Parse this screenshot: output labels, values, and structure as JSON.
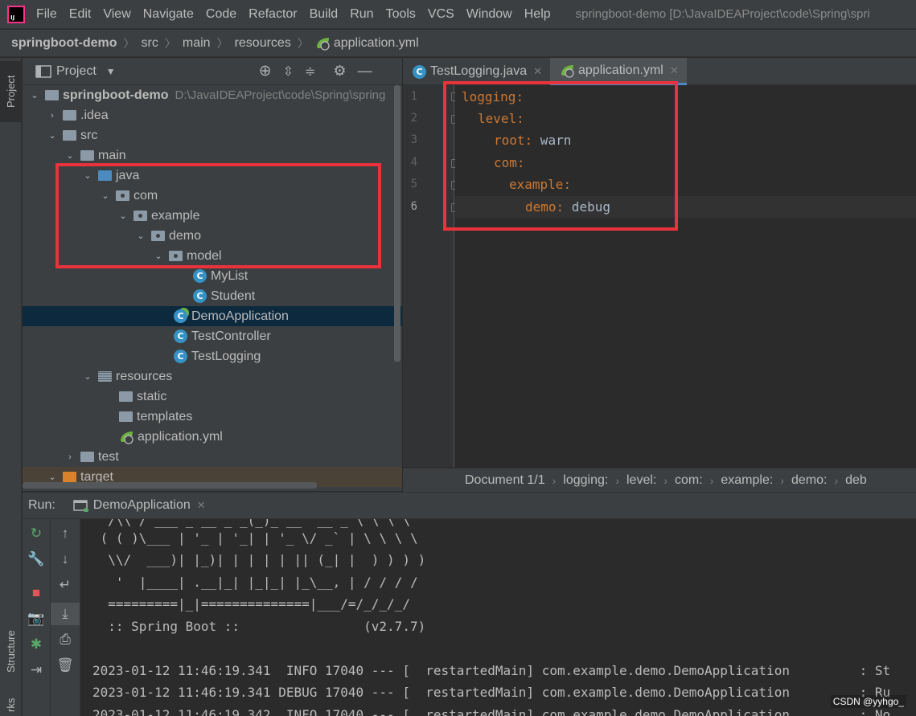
{
  "app": {
    "logo_text": "IJ",
    "window_title": "springboot-demo [D:\\JavaIDEAProject\\code\\Spring\\spri"
  },
  "menu": [
    "File",
    "Edit",
    "View",
    "Navigate",
    "Code",
    "Refactor",
    "Build",
    "Run",
    "Tools",
    "VCS",
    "Window",
    "Help"
  ],
  "breadcrumbs": [
    "springboot-demo",
    "src",
    "main",
    "resources",
    "application.yml"
  ],
  "left_strip": {
    "project_tab": "Project",
    "structure_tab": "Structure",
    "bookmarks_tab": "rks"
  },
  "project_panel": {
    "title": "Project",
    "tree": [
      {
        "label": "springboot-demo",
        "path": "D:\\JavaIDEAProject\\code\\Spring\\spring"
      },
      {
        "label": ".idea"
      },
      {
        "label": "src"
      },
      {
        "label": "main"
      },
      {
        "label": "java"
      },
      {
        "label": "com"
      },
      {
        "label": "example"
      },
      {
        "label": "demo"
      },
      {
        "label": "model"
      },
      {
        "label": "MyList"
      },
      {
        "label": "Student"
      },
      {
        "label": "DemoApplication"
      },
      {
        "label": "TestController"
      },
      {
        "label": "TestLogging"
      },
      {
        "label": "resources"
      },
      {
        "label": "static"
      },
      {
        "label": "templates"
      },
      {
        "label": "application.yml"
      },
      {
        "label": "test"
      },
      {
        "label": "target"
      }
    ]
  },
  "editor": {
    "tabs": [
      {
        "label": "TestLogging.java",
        "active": false
      },
      {
        "label": "application.yml",
        "active": true
      }
    ],
    "line_numbers": [
      "1",
      "2",
      "3",
      "4",
      "5",
      "6"
    ],
    "lines": [
      {
        "key": "logging",
        "colon": ":",
        "value": ""
      },
      {
        "key": "level",
        "colon": ":",
        "value": ""
      },
      {
        "key": "root",
        "colon": ":",
        "value": " warn"
      },
      {
        "key": "com",
        "colon": ":",
        "value": ""
      },
      {
        "key": "example",
        "colon": ":",
        "value": ""
      },
      {
        "key": "demo",
        "colon": ":",
        "value": " debug"
      }
    ],
    "status_crumbs": [
      "Document 1/1",
      "logging:",
      "level:",
      "com:",
      "example:",
      "demo:",
      "deb"
    ]
  },
  "run_panel": {
    "label": "Run:",
    "tab": "DemoApplication",
    "console_lines": [
      "  /\\\\ / ___'_ __ _ _(_)_ __  __ _ \\ \\ \\ \\",
      " ( ( )\\___ | '_ | '_| | '_ \\/ _` | \\ \\ \\ \\",
      "  \\\\/  ___)| |_)| | | | | || (_| |  ) ) ) )",
      "   '  |____| .__|_| |_|_| |_\\__, | / / / /",
      "  =========|_|==============|___/=/_/_/_/",
      "  :: Spring Boot ::                (v2.7.7)",
      "",
      "2023-01-12 11:46:19.341  INFO 17040 --- [  restartedMain] com.example.demo.DemoApplication         : St",
      "2023-01-12 11:46:19.341 DEBUG 17040 --- [  restartedMain] com.example.demo.DemoApplication         : Ru",
      "2023-01-12 11:46:19.342  INFO 17040 --- [  restartedMain] com.example.demo.DemoApplication         : No"
    ]
  },
  "watermark": "CSDN @yyhgo_",
  "colors": {
    "highlight_box": "#e8323c",
    "selection": "#0d293e",
    "accent": "#4a88c7",
    "yaml_key": "#cc7832"
  }
}
